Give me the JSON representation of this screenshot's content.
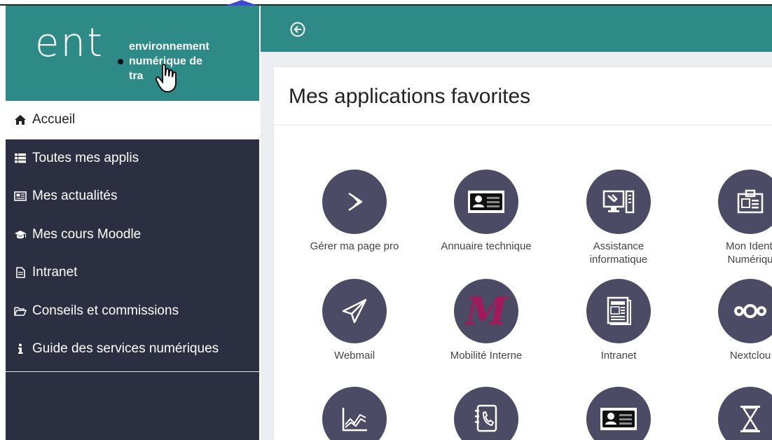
{
  "brand": {
    "logo_text": "ent",
    "tagline_line1": "environnement",
    "tagline_line2": "numérique de",
    "tagline_line3": "tra"
  },
  "colors": {
    "teal": "#2e8a87",
    "sidebar_bg": "#2c2f42",
    "icon_circle": "#4b4b66",
    "accent_magenta": "#a3195b"
  },
  "nav": {
    "items": [
      {
        "label": "Accueil",
        "icon": "home-icon",
        "active": true
      },
      {
        "label": "Toutes mes applis",
        "icon": "list-icon"
      },
      {
        "label": "Mes actualités",
        "icon": "newspaper-icon"
      },
      {
        "label": "Mes cours Moodle",
        "icon": "graduation-cap-icon"
      },
      {
        "label": "Intranet",
        "icon": "document-icon"
      },
      {
        "label": "Conseils et commissions",
        "icon": "folder-open-icon"
      },
      {
        "label": "Guide des services numériques",
        "icon": "info-icon"
      }
    ]
  },
  "header": {
    "back_icon": "arrow-circle-left-icon"
  },
  "main": {
    "title": "Mes applications favorites",
    "apps": [
      {
        "label": "Gérer ma page pro",
        "icon": "chevron-arrow-icon"
      },
      {
        "label": "Annuaire technique",
        "icon": "id-card-icon"
      },
      {
        "label": "Assistance informatique",
        "icon": "computer-tools-icon"
      },
      {
        "label": "Mon Identi Numériqu",
        "icon": "badge-icon"
      },
      {
        "label": "Webmail",
        "icon": "paper-plane-icon"
      },
      {
        "label": "Mobilité Interne",
        "icon": "letter-m-icon"
      },
      {
        "label": "Intranet",
        "icon": "newspaper-doc-icon"
      },
      {
        "label": "Nextclou",
        "icon": "nextcloud-icon"
      },
      {
        "label": "",
        "icon": "chart-lines-icon"
      },
      {
        "label": "",
        "icon": "phone-book-icon"
      },
      {
        "label": "",
        "icon": "id-card-icon"
      },
      {
        "label": "",
        "icon": "hourglass-icon"
      }
    ]
  }
}
